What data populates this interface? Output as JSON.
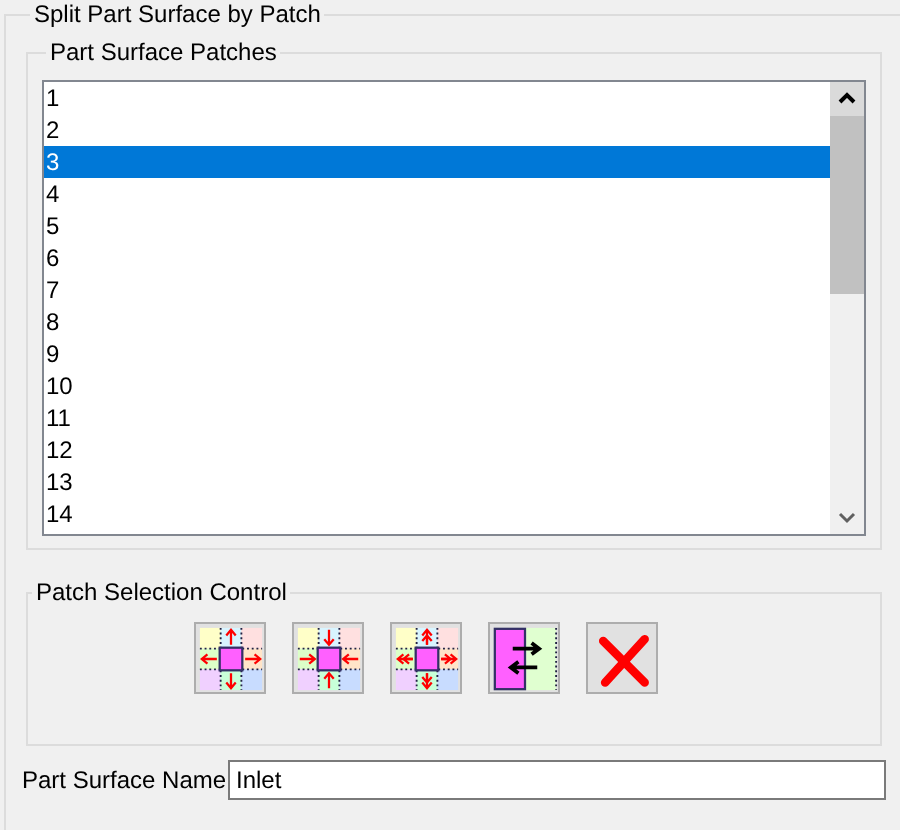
{
  "group": {
    "title": "Split Part Surface by Patch"
  },
  "patches": {
    "title": "Part Surface Patches",
    "items": [
      {
        "label": "1",
        "selected": false
      },
      {
        "label": "2",
        "selected": false
      },
      {
        "label": "3",
        "selected": true
      },
      {
        "label": "4",
        "selected": false
      },
      {
        "label": "5",
        "selected": false
      },
      {
        "label": "6",
        "selected": false
      },
      {
        "label": "7",
        "selected": false
      },
      {
        "label": "8",
        "selected": false
      },
      {
        "label": "9",
        "selected": false
      },
      {
        "label": "10",
        "selected": false
      },
      {
        "label": "11",
        "selected": false
      },
      {
        "label": "12",
        "selected": false
      },
      {
        "label": "13",
        "selected": false
      },
      {
        "label": "14",
        "selected": false
      }
    ]
  },
  "selection_control": {
    "title": "Patch Selection Control",
    "buttons": [
      {
        "kind": "grow"
      },
      {
        "kind": "shrink"
      },
      {
        "kind": "grow_all"
      },
      {
        "kind": "invert"
      },
      {
        "kind": "clear"
      }
    ]
  },
  "name_field": {
    "label": "Part Surface Name",
    "value": "Inlet"
  }
}
